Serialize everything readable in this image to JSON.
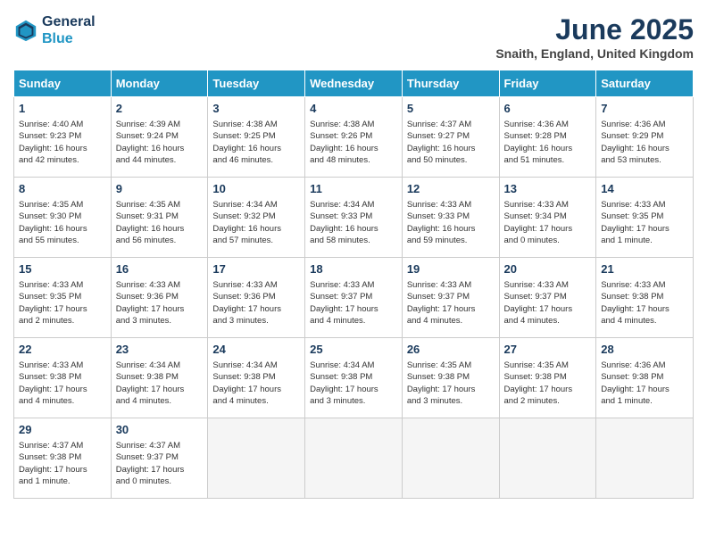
{
  "header": {
    "logo_line1": "General",
    "logo_line2": "Blue",
    "month_title": "June 2025",
    "subtitle": "Snaith, England, United Kingdom"
  },
  "days_of_week": [
    "Sunday",
    "Monday",
    "Tuesday",
    "Wednesday",
    "Thursday",
    "Friday",
    "Saturday"
  ],
  "weeks": [
    [
      {
        "day": "1",
        "info": "Sunrise: 4:40 AM\nSunset: 9:23 PM\nDaylight: 16 hours\nand 42 minutes."
      },
      {
        "day": "2",
        "info": "Sunrise: 4:39 AM\nSunset: 9:24 PM\nDaylight: 16 hours\nand 44 minutes."
      },
      {
        "day": "3",
        "info": "Sunrise: 4:38 AM\nSunset: 9:25 PM\nDaylight: 16 hours\nand 46 minutes."
      },
      {
        "day": "4",
        "info": "Sunrise: 4:38 AM\nSunset: 9:26 PM\nDaylight: 16 hours\nand 48 minutes."
      },
      {
        "day": "5",
        "info": "Sunrise: 4:37 AM\nSunset: 9:27 PM\nDaylight: 16 hours\nand 50 minutes."
      },
      {
        "day": "6",
        "info": "Sunrise: 4:36 AM\nSunset: 9:28 PM\nDaylight: 16 hours\nand 51 minutes."
      },
      {
        "day": "7",
        "info": "Sunrise: 4:36 AM\nSunset: 9:29 PM\nDaylight: 16 hours\nand 53 minutes."
      }
    ],
    [
      {
        "day": "8",
        "info": "Sunrise: 4:35 AM\nSunset: 9:30 PM\nDaylight: 16 hours\nand 55 minutes."
      },
      {
        "day": "9",
        "info": "Sunrise: 4:35 AM\nSunset: 9:31 PM\nDaylight: 16 hours\nand 56 minutes."
      },
      {
        "day": "10",
        "info": "Sunrise: 4:34 AM\nSunset: 9:32 PM\nDaylight: 16 hours\nand 57 minutes."
      },
      {
        "day": "11",
        "info": "Sunrise: 4:34 AM\nSunset: 9:33 PM\nDaylight: 16 hours\nand 58 minutes."
      },
      {
        "day": "12",
        "info": "Sunrise: 4:33 AM\nSunset: 9:33 PM\nDaylight: 16 hours\nand 59 minutes."
      },
      {
        "day": "13",
        "info": "Sunrise: 4:33 AM\nSunset: 9:34 PM\nDaylight: 17 hours\nand 0 minutes."
      },
      {
        "day": "14",
        "info": "Sunrise: 4:33 AM\nSunset: 9:35 PM\nDaylight: 17 hours\nand 1 minute."
      }
    ],
    [
      {
        "day": "15",
        "info": "Sunrise: 4:33 AM\nSunset: 9:35 PM\nDaylight: 17 hours\nand 2 minutes."
      },
      {
        "day": "16",
        "info": "Sunrise: 4:33 AM\nSunset: 9:36 PM\nDaylight: 17 hours\nand 3 minutes."
      },
      {
        "day": "17",
        "info": "Sunrise: 4:33 AM\nSunset: 9:36 PM\nDaylight: 17 hours\nand 3 minutes."
      },
      {
        "day": "18",
        "info": "Sunrise: 4:33 AM\nSunset: 9:37 PM\nDaylight: 17 hours\nand 4 minutes."
      },
      {
        "day": "19",
        "info": "Sunrise: 4:33 AM\nSunset: 9:37 PM\nDaylight: 17 hours\nand 4 minutes."
      },
      {
        "day": "20",
        "info": "Sunrise: 4:33 AM\nSunset: 9:37 PM\nDaylight: 17 hours\nand 4 minutes."
      },
      {
        "day": "21",
        "info": "Sunrise: 4:33 AM\nSunset: 9:38 PM\nDaylight: 17 hours\nand 4 minutes."
      }
    ],
    [
      {
        "day": "22",
        "info": "Sunrise: 4:33 AM\nSunset: 9:38 PM\nDaylight: 17 hours\nand 4 minutes."
      },
      {
        "day": "23",
        "info": "Sunrise: 4:34 AM\nSunset: 9:38 PM\nDaylight: 17 hours\nand 4 minutes."
      },
      {
        "day": "24",
        "info": "Sunrise: 4:34 AM\nSunset: 9:38 PM\nDaylight: 17 hours\nand 4 minutes."
      },
      {
        "day": "25",
        "info": "Sunrise: 4:34 AM\nSunset: 9:38 PM\nDaylight: 17 hours\nand 3 minutes."
      },
      {
        "day": "26",
        "info": "Sunrise: 4:35 AM\nSunset: 9:38 PM\nDaylight: 17 hours\nand 3 minutes."
      },
      {
        "day": "27",
        "info": "Sunrise: 4:35 AM\nSunset: 9:38 PM\nDaylight: 17 hours\nand 2 minutes."
      },
      {
        "day": "28",
        "info": "Sunrise: 4:36 AM\nSunset: 9:38 PM\nDaylight: 17 hours\nand 1 minute."
      }
    ],
    [
      {
        "day": "29",
        "info": "Sunrise: 4:37 AM\nSunset: 9:38 PM\nDaylight: 17 hours\nand 1 minute."
      },
      {
        "day": "30",
        "info": "Sunrise: 4:37 AM\nSunset: 9:37 PM\nDaylight: 17 hours\nand 0 minutes."
      },
      {
        "day": "",
        "info": ""
      },
      {
        "day": "",
        "info": ""
      },
      {
        "day": "",
        "info": ""
      },
      {
        "day": "",
        "info": ""
      },
      {
        "day": "",
        "info": ""
      }
    ]
  ]
}
